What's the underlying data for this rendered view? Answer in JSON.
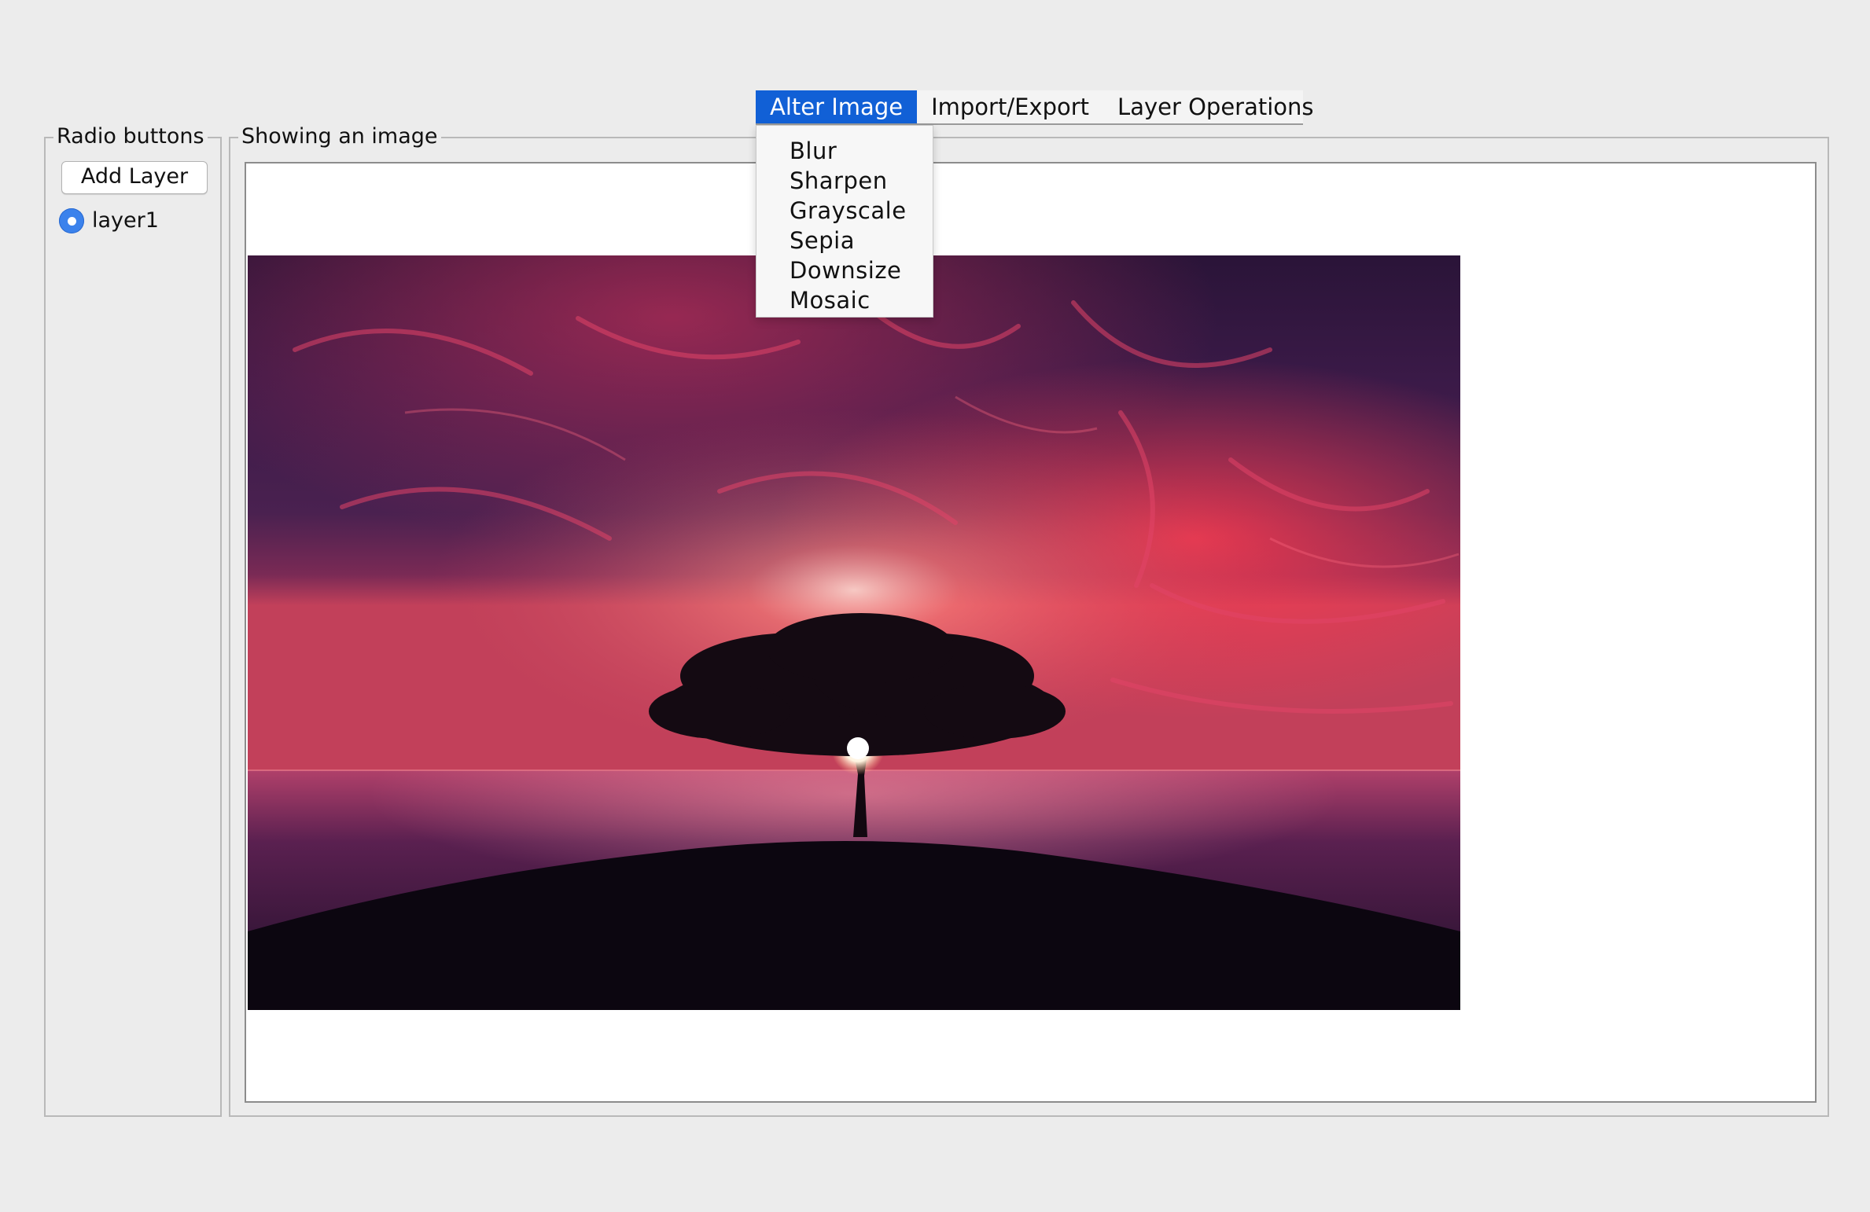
{
  "menubar": {
    "menus": [
      {
        "label": "Alter Image",
        "active": true
      },
      {
        "label": "Import/Export",
        "active": false
      },
      {
        "label": "Layer Operations",
        "active": false
      }
    ]
  },
  "dropdown": {
    "items": [
      "Blur",
      "Sharpen",
      "Grayscale",
      "Sepia",
      "Downsize",
      "Mosaic"
    ]
  },
  "left_panel": {
    "title": "Radio buttons",
    "add_layer_label": "Add Layer",
    "layers": [
      {
        "label": "layer1",
        "selected": true
      }
    ]
  },
  "image_panel": {
    "title": "Showing an image",
    "image_description_icon": "photo-icon"
  },
  "colors": {
    "accent": "#1160d6",
    "radio": "#3b82ec",
    "background": "#ececec"
  }
}
